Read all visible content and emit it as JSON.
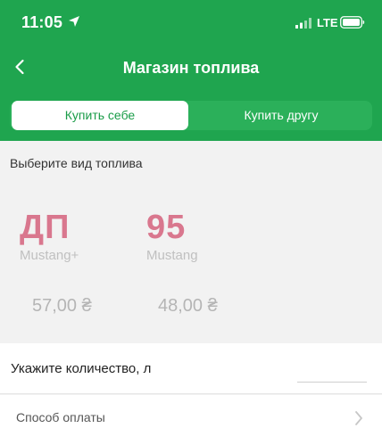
{
  "status_bar": {
    "time": "11:05",
    "network": "LTE"
  },
  "nav": {
    "title": "Магазин топлива"
  },
  "tabs": [
    {
      "label": "Купить себе",
      "active": true
    },
    {
      "label": "Купить другу",
      "active": false
    }
  ],
  "fuel_section": {
    "label": "Выберите вид топлива",
    "items": [
      {
        "code": "ДП",
        "brand": "Mustang+",
        "price": "57,00 ₴"
      },
      {
        "code": "95",
        "brand": "Mustang",
        "price": "48,00 ₴"
      }
    ]
  },
  "quantity": {
    "label": "Укажите количество, л",
    "value": ""
  },
  "payment": {
    "label": "Способ оплаты"
  },
  "colors": {
    "brand_green": "#1fa54f",
    "fuel_code": "#d9778e"
  }
}
